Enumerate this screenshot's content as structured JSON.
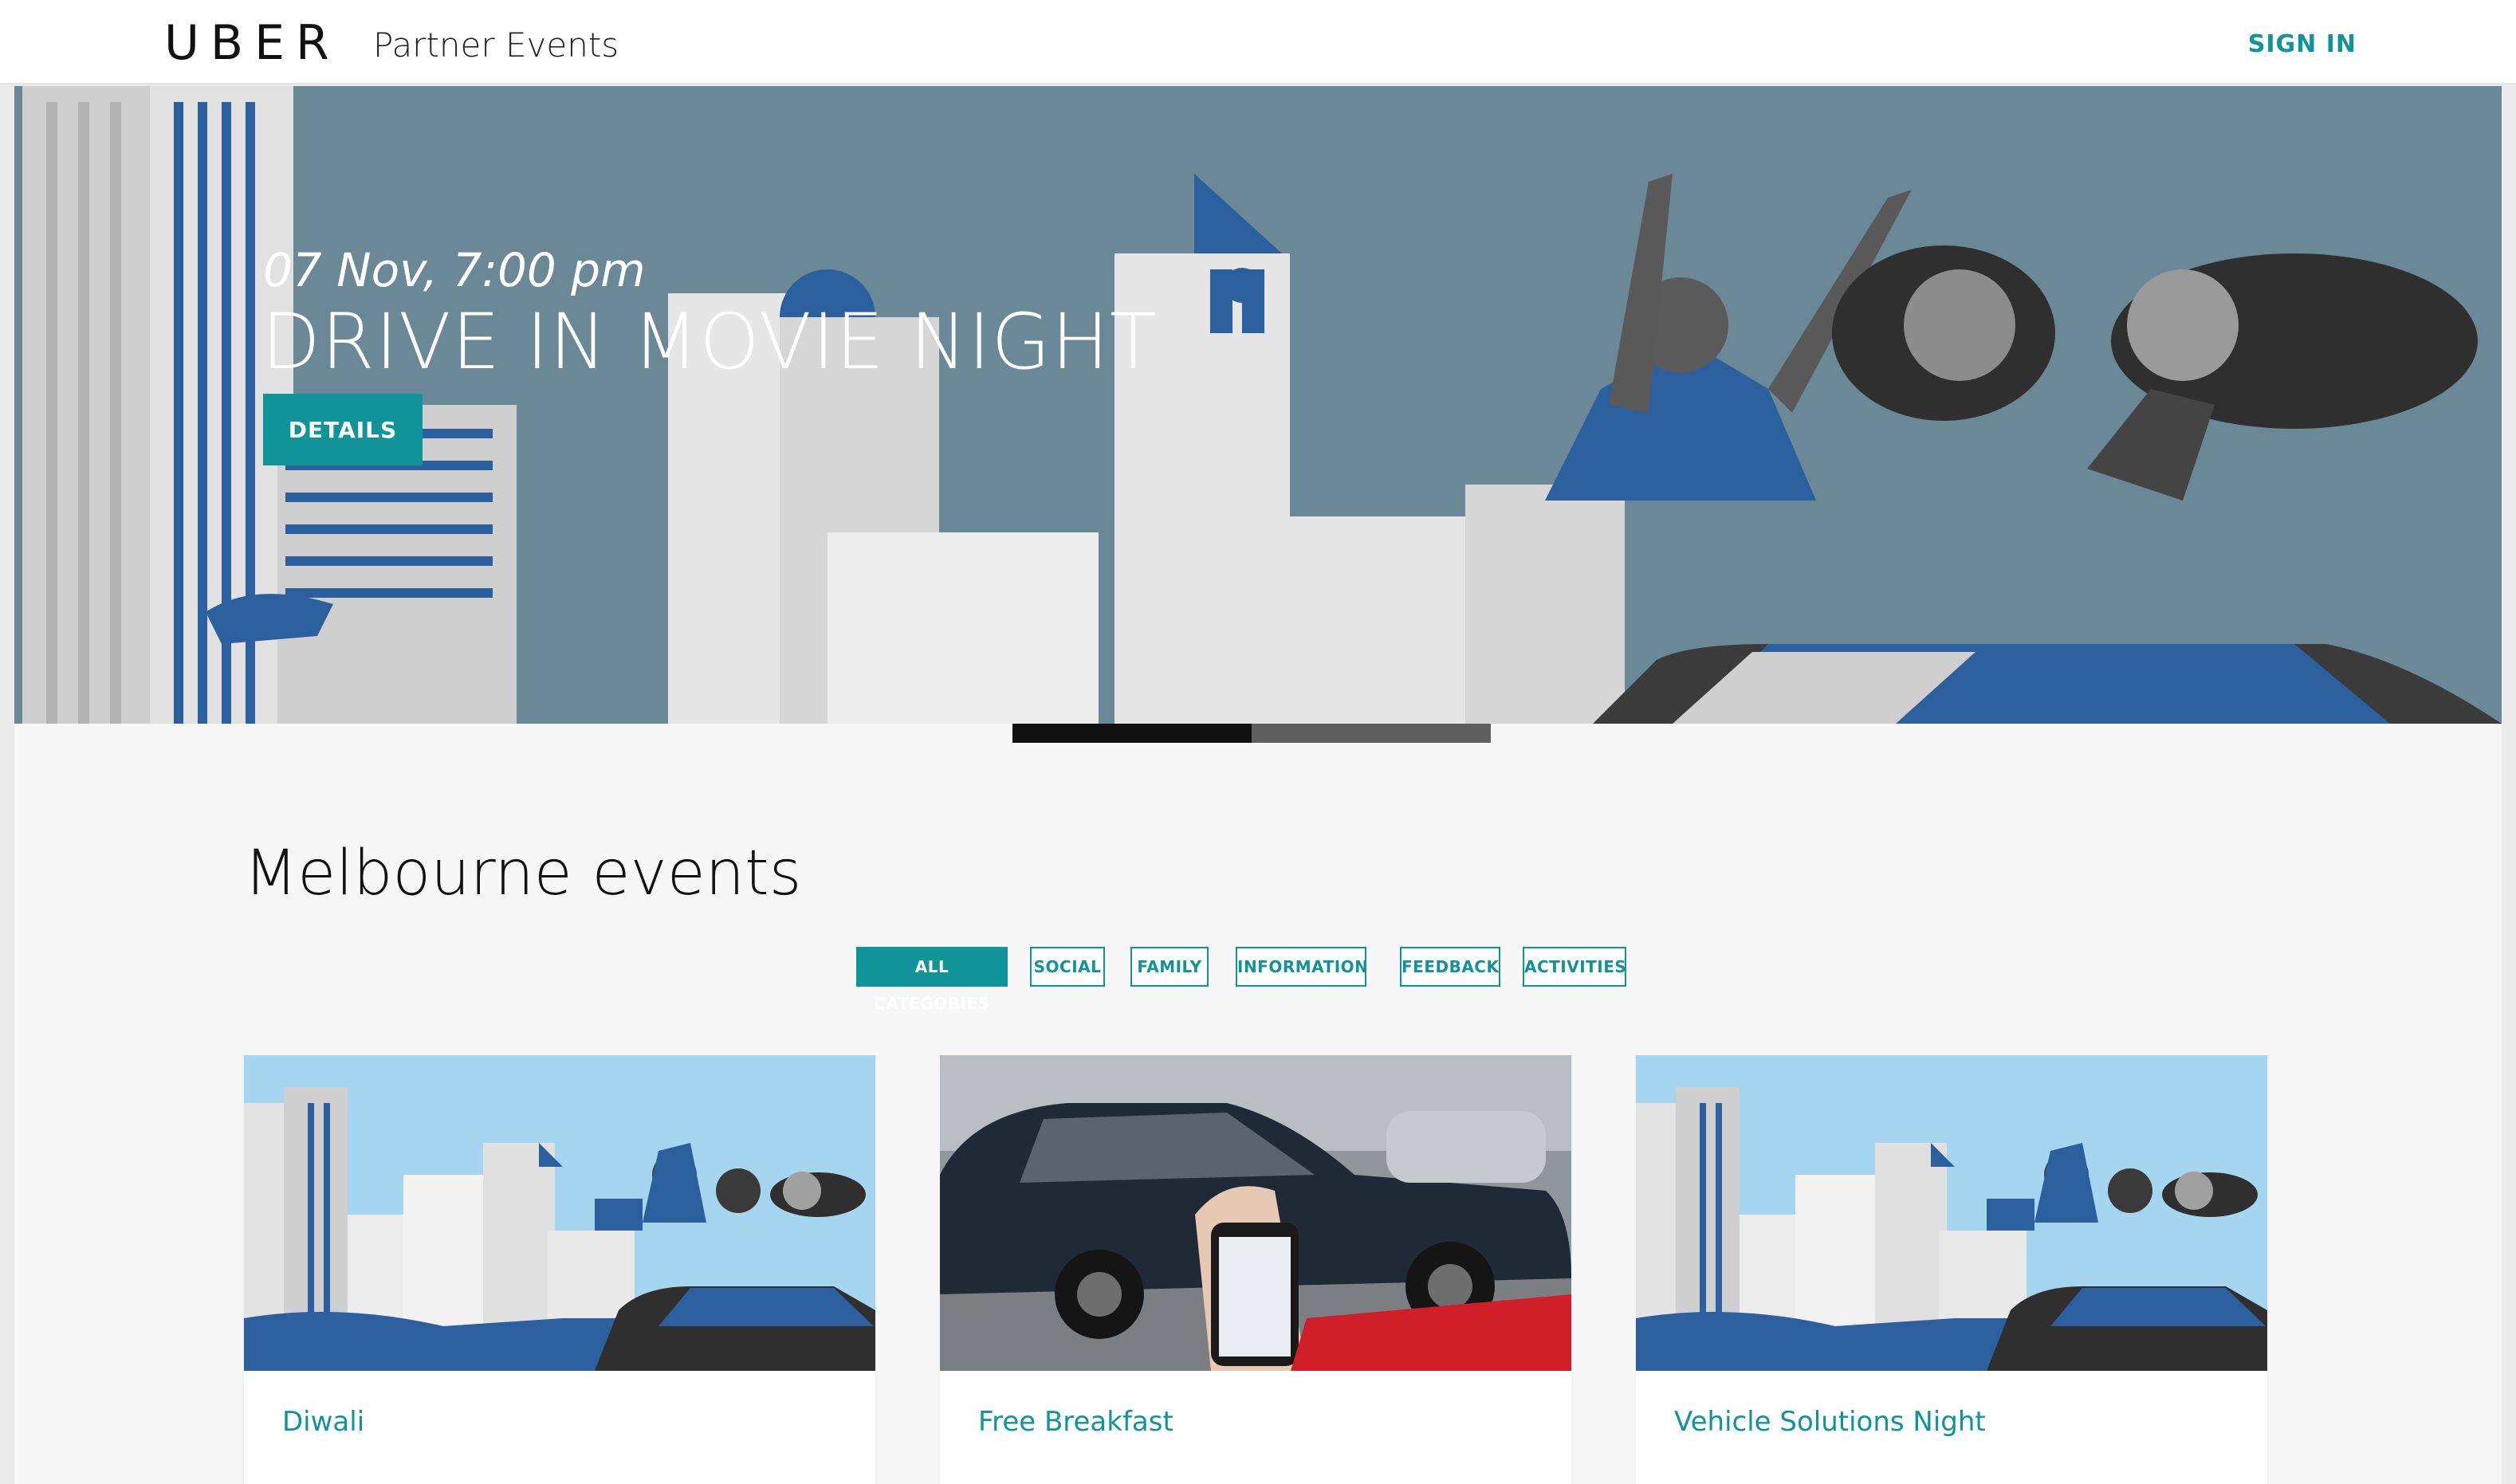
{
  "header": {
    "logo": "UBER",
    "subtitle": "Partner Events",
    "signin_label": "SIGN IN"
  },
  "hero": {
    "date": "07 Nov, 7:00 pm",
    "title": "DRIVE IN MOVIE NIGHT",
    "details_label": "DETAILS",
    "carousel_active_index": 0,
    "carousel_count": 2
  },
  "main": {
    "section_title": "Melbourne events",
    "filters": [
      {
        "label": "ALL CATEGORIES",
        "active": true
      },
      {
        "label": "SOCIAL",
        "active": false
      },
      {
        "label": "FAMILY",
        "active": false
      },
      {
        "label": "INFORMATION",
        "active": false
      },
      {
        "label": "FEEDBACK",
        "active": false
      },
      {
        "label": "ACTIVITIES",
        "active": false
      }
    ],
    "events": [
      {
        "title": "Diwali",
        "image": "illustration-drive-in"
      },
      {
        "title": "Free Breakfast",
        "image": "photo-car-phone"
      },
      {
        "title": "Vehicle Solutions Night",
        "image": "illustration-drive-in"
      }
    ]
  },
  "colors": {
    "accent": "#11939a",
    "hero_bg": "#6c8896",
    "page_bg": "#f7f7f7"
  }
}
